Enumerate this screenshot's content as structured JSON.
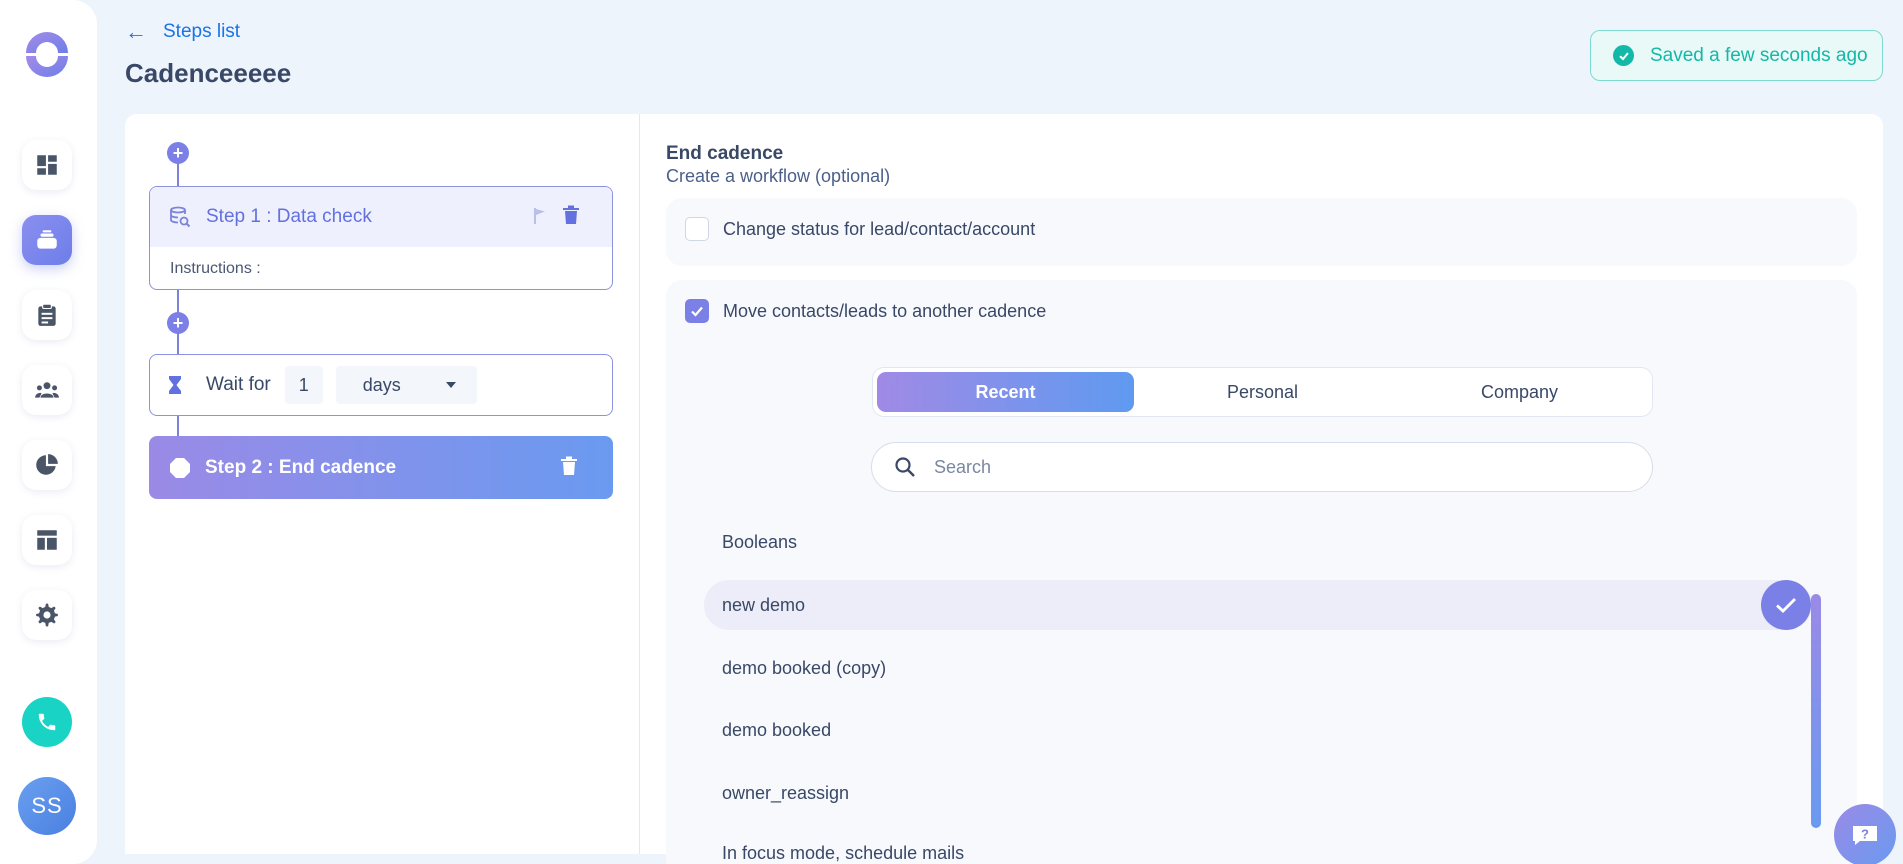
{
  "header": {
    "back_label": "Steps list",
    "title": "Cadenceeeee",
    "saved_status": "Saved a few seconds ago"
  },
  "sidebar": {
    "items": [
      {
        "icon": "dashboard-icon",
        "active": false
      },
      {
        "icon": "cadence-icon",
        "active": true
      },
      {
        "icon": "tasks-icon",
        "active": false
      },
      {
        "icon": "people-icon",
        "active": false
      },
      {
        "icon": "pie-chart-icon",
        "active": false
      },
      {
        "icon": "templates-icon",
        "active": false
      },
      {
        "icon": "gear-icon",
        "active": false
      }
    ],
    "avatar_initials": "SS"
  },
  "steps": {
    "step1_title": "Step 1 : Data check",
    "step1_instructions": "Instructions :",
    "wait_label": "Wait for",
    "wait_value": "1",
    "wait_unit": "days",
    "end_title": "Step 2 : End cadence"
  },
  "end_cadence": {
    "title": "End cadence",
    "subtitle": "Create a workflow (optional)",
    "option_status": {
      "label": "Change status for lead/contact/account",
      "checked": false
    },
    "option_move": {
      "label": "Move contacts/leads to another cadence",
      "checked": true
    },
    "tabs": [
      "Recent",
      "Personal",
      "Company"
    ],
    "active_tab": "Recent",
    "search_placeholder": "Search",
    "search_value": "",
    "cadences": [
      "Booleans",
      "new demo",
      "demo booked (copy)",
      "demo booked",
      "owner_reassign",
      "In focus mode, schedule mails"
    ],
    "selected_cadence": "new demo"
  },
  "colors": {
    "accent": "#7a80e5",
    "saved_teal": "#14b8a6",
    "phone_teal": "#19d3c5",
    "link_blue": "#1a73e8"
  }
}
